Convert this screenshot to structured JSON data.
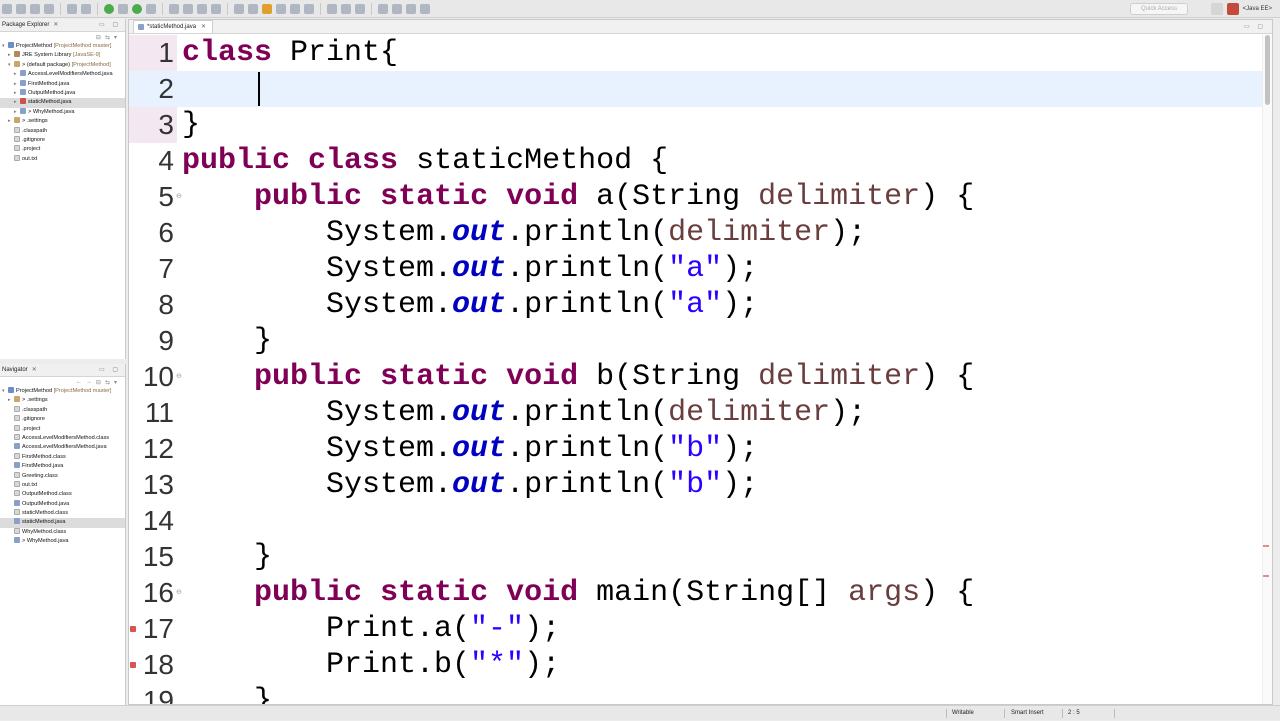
{
  "perspective": {
    "quick_access_placeholder": "Quick Access",
    "active": "<Java EE>"
  },
  "package_explorer": {
    "title": "Package Explorer",
    "items": [
      {
        "label": "ProjectMethod",
        "decor": " [ProjectMethod master]",
        "depth": 0,
        "arrow": "▾",
        "icon": "proj"
      },
      {
        "label": "JRE System Library",
        "decor": " [JavaSE-9]",
        "depth": 1,
        "arrow": "▸",
        "icon": "lib"
      },
      {
        "label": "> (default package)",
        "decor": " [ProjectMethod]",
        "depth": 1,
        "arrow": "▾",
        "icon": "pkg"
      },
      {
        "label": "AccessLevelModifiersMethod.java",
        "decor": "",
        "depth": 2,
        "arrow": "▸",
        "icon": "j"
      },
      {
        "label": "FirstMethod.java",
        "decor": "",
        "depth": 2,
        "arrow": "▸",
        "icon": "j"
      },
      {
        "label": "OutputMethod.java",
        "decor": "",
        "depth": 2,
        "arrow": "▸",
        "icon": "j"
      },
      {
        "label": "staticMethod.java",
        "decor": "",
        "depth": 2,
        "arrow": "▸",
        "icon": "err",
        "selected": true
      },
      {
        "label": "> WhyMethod.java",
        "decor": "",
        "depth": 2,
        "arrow": "▸",
        "icon": "j"
      },
      {
        "label": "> .settings",
        "decor": "",
        "depth": 1,
        "arrow": "▸",
        "icon": "pkg"
      },
      {
        "label": ".classpath",
        "decor": "",
        "depth": 1,
        "arrow": "",
        "icon": "f"
      },
      {
        "label": ".gitignore",
        "decor": "",
        "depth": 1,
        "arrow": "",
        "icon": "f"
      },
      {
        "label": ".project",
        "decor": "",
        "depth": 1,
        "arrow": "",
        "icon": "f"
      },
      {
        "label": "out.txt",
        "decor": "",
        "depth": 1,
        "arrow": "",
        "icon": "f"
      }
    ]
  },
  "navigator": {
    "title": "Navigator",
    "items": [
      {
        "label": "ProjectMethod",
        "decor": " [ProjectMethod master]",
        "depth": 0,
        "arrow": "▾",
        "icon": "proj"
      },
      {
        "label": "> .settings",
        "decor": "",
        "depth": 1,
        "arrow": "▸",
        "icon": "pkg"
      },
      {
        "label": ".classpath",
        "decor": "",
        "depth": 1,
        "arrow": "",
        "icon": "f"
      },
      {
        "label": ".gitignore",
        "decor": "",
        "depth": 1,
        "arrow": "",
        "icon": "f"
      },
      {
        "label": ".project",
        "decor": "",
        "depth": 1,
        "arrow": "",
        "icon": "f"
      },
      {
        "label": "AccessLevelModifiersMethod.class",
        "decor": "",
        "depth": 1,
        "arrow": "",
        "icon": "f"
      },
      {
        "label": "AccessLevelModifiersMethod.java",
        "decor": "",
        "depth": 1,
        "arrow": "",
        "icon": "j"
      },
      {
        "label": "FirstMethod.class",
        "decor": "",
        "depth": 1,
        "arrow": "",
        "icon": "f"
      },
      {
        "label": "FirstMethod.java",
        "decor": "",
        "depth": 1,
        "arrow": "",
        "icon": "j"
      },
      {
        "label": "Greeting.class",
        "decor": "",
        "depth": 1,
        "arrow": "",
        "icon": "f"
      },
      {
        "label": "out.txt",
        "decor": "",
        "depth": 1,
        "arrow": "",
        "icon": "f"
      },
      {
        "label": "OutputMethod.class",
        "decor": "",
        "depth": 1,
        "arrow": "",
        "icon": "f"
      },
      {
        "label": "OutputMethod.java",
        "decor": "",
        "depth": 1,
        "arrow": "",
        "icon": "j"
      },
      {
        "label": "staticMethod.class",
        "decor": "",
        "depth": 1,
        "arrow": "",
        "icon": "f"
      },
      {
        "label": "staticMethod.java",
        "decor": "",
        "depth": 1,
        "arrow": "",
        "icon": "j",
        "selected": true
      },
      {
        "label": "WhyMethod.class",
        "decor": "",
        "depth": 1,
        "arrow": "",
        "icon": "f"
      },
      {
        "label": "> WhyMethod.java",
        "decor": "",
        "depth": 1,
        "arrow": "",
        "icon": "j"
      }
    ]
  },
  "editor": {
    "tab_label": "*staticMethod.java",
    "lines": [
      {
        "n": "1",
        "tokens": [
          [
            "kw",
            "class"
          ],
          [
            "t",
            " Print{"
          ]
        ]
      },
      {
        "n": "2",
        "tokens": [
          [
            "t",
            "\t"
          ]
        ],
        "current": true
      },
      {
        "n": "3",
        "tokens": [
          [
            "t",
            "}"
          ]
        ]
      },
      {
        "n": "4",
        "tokens": [
          [
            "kw",
            "public"
          ],
          [
            "t",
            " "
          ],
          [
            "kw",
            "class"
          ],
          [
            "t",
            " staticMethod {"
          ]
        ]
      },
      {
        "n": "5",
        "fold": true,
        "tokens": [
          [
            "t",
            "    "
          ],
          [
            "kw",
            "public"
          ],
          [
            "t",
            " "
          ],
          [
            "kw",
            "static"
          ],
          [
            "t",
            " "
          ],
          [
            "kw",
            "void"
          ],
          [
            "t",
            " a(String "
          ],
          [
            "var",
            "delimiter"
          ],
          [
            "t",
            ") {"
          ]
        ]
      },
      {
        "n": "6",
        "tokens": [
          [
            "t",
            "        System."
          ],
          [
            "fld",
            "out"
          ],
          [
            "t",
            ".println("
          ],
          [
            "var",
            "delimiter"
          ],
          [
            "t",
            ");"
          ]
        ]
      },
      {
        "n": "7",
        "tokens": [
          [
            "t",
            "        System."
          ],
          [
            "fld",
            "out"
          ],
          [
            "t",
            ".println("
          ],
          [
            "str",
            "\"a\""
          ],
          [
            "t",
            ");"
          ]
        ]
      },
      {
        "n": "8",
        "tokens": [
          [
            "t",
            "        System."
          ],
          [
            "fld",
            "out"
          ],
          [
            "t",
            ".println("
          ],
          [
            "str",
            "\"a\""
          ],
          [
            "t",
            ");"
          ]
        ]
      },
      {
        "n": "9",
        "tokens": [
          [
            "t",
            "    }"
          ]
        ]
      },
      {
        "n": "10",
        "fold": true,
        "tokens": [
          [
            "t",
            "    "
          ],
          [
            "kw",
            "public"
          ],
          [
            "t",
            " "
          ],
          [
            "kw",
            "static"
          ],
          [
            "t",
            " "
          ],
          [
            "kw",
            "void"
          ],
          [
            "t",
            " b(String "
          ],
          [
            "var",
            "delimiter"
          ],
          [
            "t",
            ") {"
          ]
        ]
      },
      {
        "n": "11",
        "tokens": [
          [
            "t",
            "        System."
          ],
          [
            "fld",
            "out"
          ],
          [
            "t",
            ".println("
          ],
          [
            "var",
            "delimiter"
          ],
          [
            "t",
            ");"
          ]
        ]
      },
      {
        "n": "12",
        "tokens": [
          [
            "t",
            "        System."
          ],
          [
            "fld",
            "out"
          ],
          [
            "t",
            ".println("
          ],
          [
            "str",
            "\"b\""
          ],
          [
            "t",
            ");"
          ]
        ]
      },
      {
        "n": "13",
        "tokens": [
          [
            "t",
            "        System."
          ],
          [
            "fld",
            "out"
          ],
          [
            "t",
            ".println("
          ],
          [
            "str",
            "\"b\""
          ],
          [
            "t",
            ");"
          ]
        ]
      },
      {
        "n": "14",
        "tokens": [
          [
            "t",
            ""
          ]
        ]
      },
      {
        "n": "15",
        "tokens": [
          [
            "t",
            "    }"
          ]
        ]
      },
      {
        "n": "16",
        "fold": true,
        "tokens": [
          [
            "t",
            "    "
          ],
          [
            "kw",
            "public"
          ],
          [
            "t",
            " "
          ],
          [
            "kw",
            "static"
          ],
          [
            "t",
            " "
          ],
          [
            "kw",
            "void"
          ],
          [
            "t",
            " main(String[] "
          ],
          [
            "var",
            "args"
          ],
          [
            "t",
            ") {"
          ]
        ]
      },
      {
        "n": "17",
        "error": true,
        "tokens": [
          [
            "t",
            "        Print.a("
          ],
          [
            "str",
            "\"-\""
          ],
          [
            "t",
            ");"
          ]
        ]
      },
      {
        "n": "18",
        "error": true,
        "tokens": [
          [
            "t",
            "        Print.b("
          ],
          [
            "str",
            "\"*\""
          ],
          [
            "t",
            ");"
          ]
        ]
      },
      {
        "n": "19",
        "tokens": [
          [
            "t",
            "    }"
          ]
        ]
      }
    ]
  },
  "status": {
    "writable": "Writable",
    "insert_mode": "Smart Insert",
    "position": "2 : 5"
  }
}
